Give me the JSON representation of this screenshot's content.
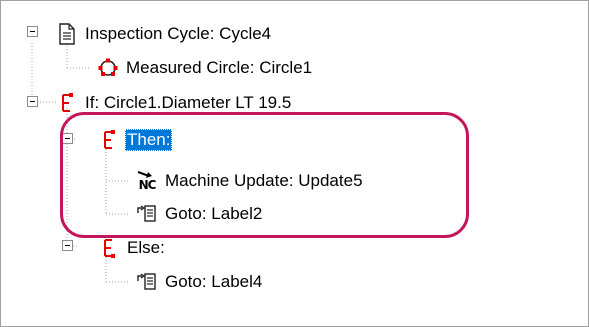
{
  "tree": {
    "nodes": [
      {
        "label": "Inspection Cycle: Cycle4",
        "icon": "document-icon"
      },
      {
        "label": "Measured Circle: Circle1",
        "icon": "measured-circle-icon"
      },
      {
        "label": "If: Circle1.Diameter LT 19.5",
        "icon": "branch-if-icon"
      },
      {
        "label": "Then:",
        "icon": "branch-then-icon",
        "selected": true
      },
      {
        "label": "Machine Update: Update5",
        "icon": "nc-machine-update-icon"
      },
      {
        "label": "Goto: Label2",
        "icon": "goto-icon"
      },
      {
        "label": "Else:",
        "icon": "branch-else-icon"
      },
      {
        "label": "Goto: Label4",
        "icon": "goto-icon"
      }
    ],
    "nc_icon_text": "NC"
  },
  "colors": {
    "selection": "#0078d7",
    "annotation": "#c2185b",
    "branch_red": "#e60000",
    "guide_lines": "#a6a6a6",
    "frame": "#a0a0a0"
  }
}
